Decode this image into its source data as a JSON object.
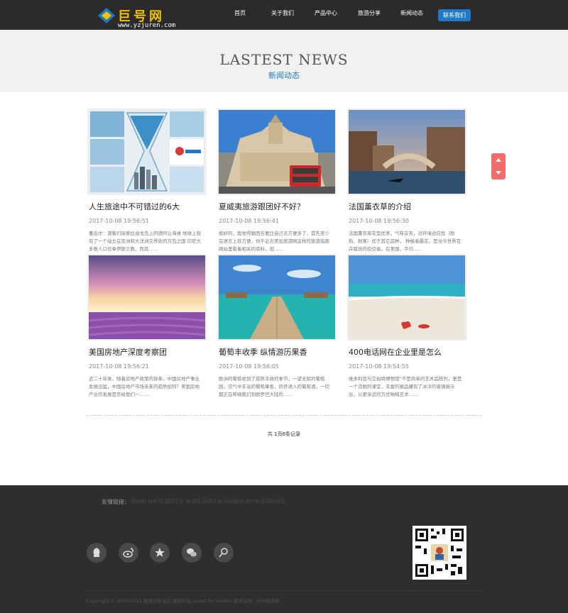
{
  "header": {
    "logo_text": "巨号网",
    "logo_url": "www.yzjuren.com",
    "nav": [
      "首页",
      "关于我们",
      "产品中心",
      "旅游分享",
      "新闻动态"
    ],
    "contact_label": "联系我们"
  },
  "banner": {
    "title": "LASTEST NEWS",
    "subtitle": "新闻动态"
  },
  "articles": [
    {
      "title": "人生旅途中不可错过的6大",
      "date": "2017-10-08 19:56:51",
      "excerpt": "董岳尔：游客们探索拉迪戈岛上的德阿让海滩 地球上就有了一个站立在亚洲和大洋洲交界处的万岛之国 印尼大多数人口信奉伊斯兰教，而其……",
      "image": "hourglass-city"
    },
    {
      "title": "夏威夷旅游跟团好不好？",
      "date": "2017-10-08 19:56:41",
      "excerpt": "姐好的，我觉得跟团去要比自己去方便多了，首先至少在语言上就方便，你不必去美加旅游网这样的旅游指南网站里看着相关的资料，但……",
      "image": "london-bus"
    },
    {
      "title": "法国薰衣草的介绍",
      "date": "2017-10-08 19:56:30",
      "excerpt": "法国薰衣草花型优美，气味芬芳，对环境适应性（耐热、耐寒）优于其它品种， 种植者最花，是当今世界花卉栽培的佼佼者。在美国，平均……",
      "image": "venice"
    },
    {
      "title": "美国房地产深度考察团",
      "date": "2017-10-08 19:56:21",
      "excerpt": "近二十年来，随着房地产政策的放革，中国房地产事业发展迅猛，中国房地产市场未来的趋势如何？美国房地产业的发展是否给我们一……",
      "image": "lavender"
    },
    {
      "title": "葡萄丰收季 纵情游历果香",
      "date": "2017-10-08 19:56:05",
      "excerpt": "欧洲的葡萄收到了成熟丰收的季节，一望无际的葡萄园，空气中丰溢的葡萄果香，挤挤诱人的葡萄酒，一切都正在呼唤我们到欧罗巴大陆的……",
      "image": "maldives"
    },
    {
      "title": "400电话网在企业里是怎么",
      "date": "2017-10-08 19:54:55",
      "excerpt": "维多利亚与艾伯特博物馆”不是简单的艺术品陈列，更是一个活脱的课堂，丰富的展品攫有了冰冷的玻璃展示台，以更亲近的方式呐喊艺术……",
      "image": "beach"
    }
  ],
  "paging": "共 1页6条记录",
  "footer": {
    "links_label": "友情链接：",
    "links": "钢结构 自考网 建网平台 电话网 网站开发 网站制作 400电话 网站建设",
    "social": [
      "qq-icon",
      "weibo-icon",
      "star-icon",
      "wechat-icon",
      "search-icon"
    ],
    "copyright": "Copyright © 2002-2011 旅游分享企业 版权所有 power by YouRen 技术支持：400电话网"
  },
  "colors": {
    "accent": "#1f79c5",
    "header_bg": "#2b2b2b",
    "footer_bg": "#2e2e2e",
    "side_tab": "#f46b6b"
  }
}
